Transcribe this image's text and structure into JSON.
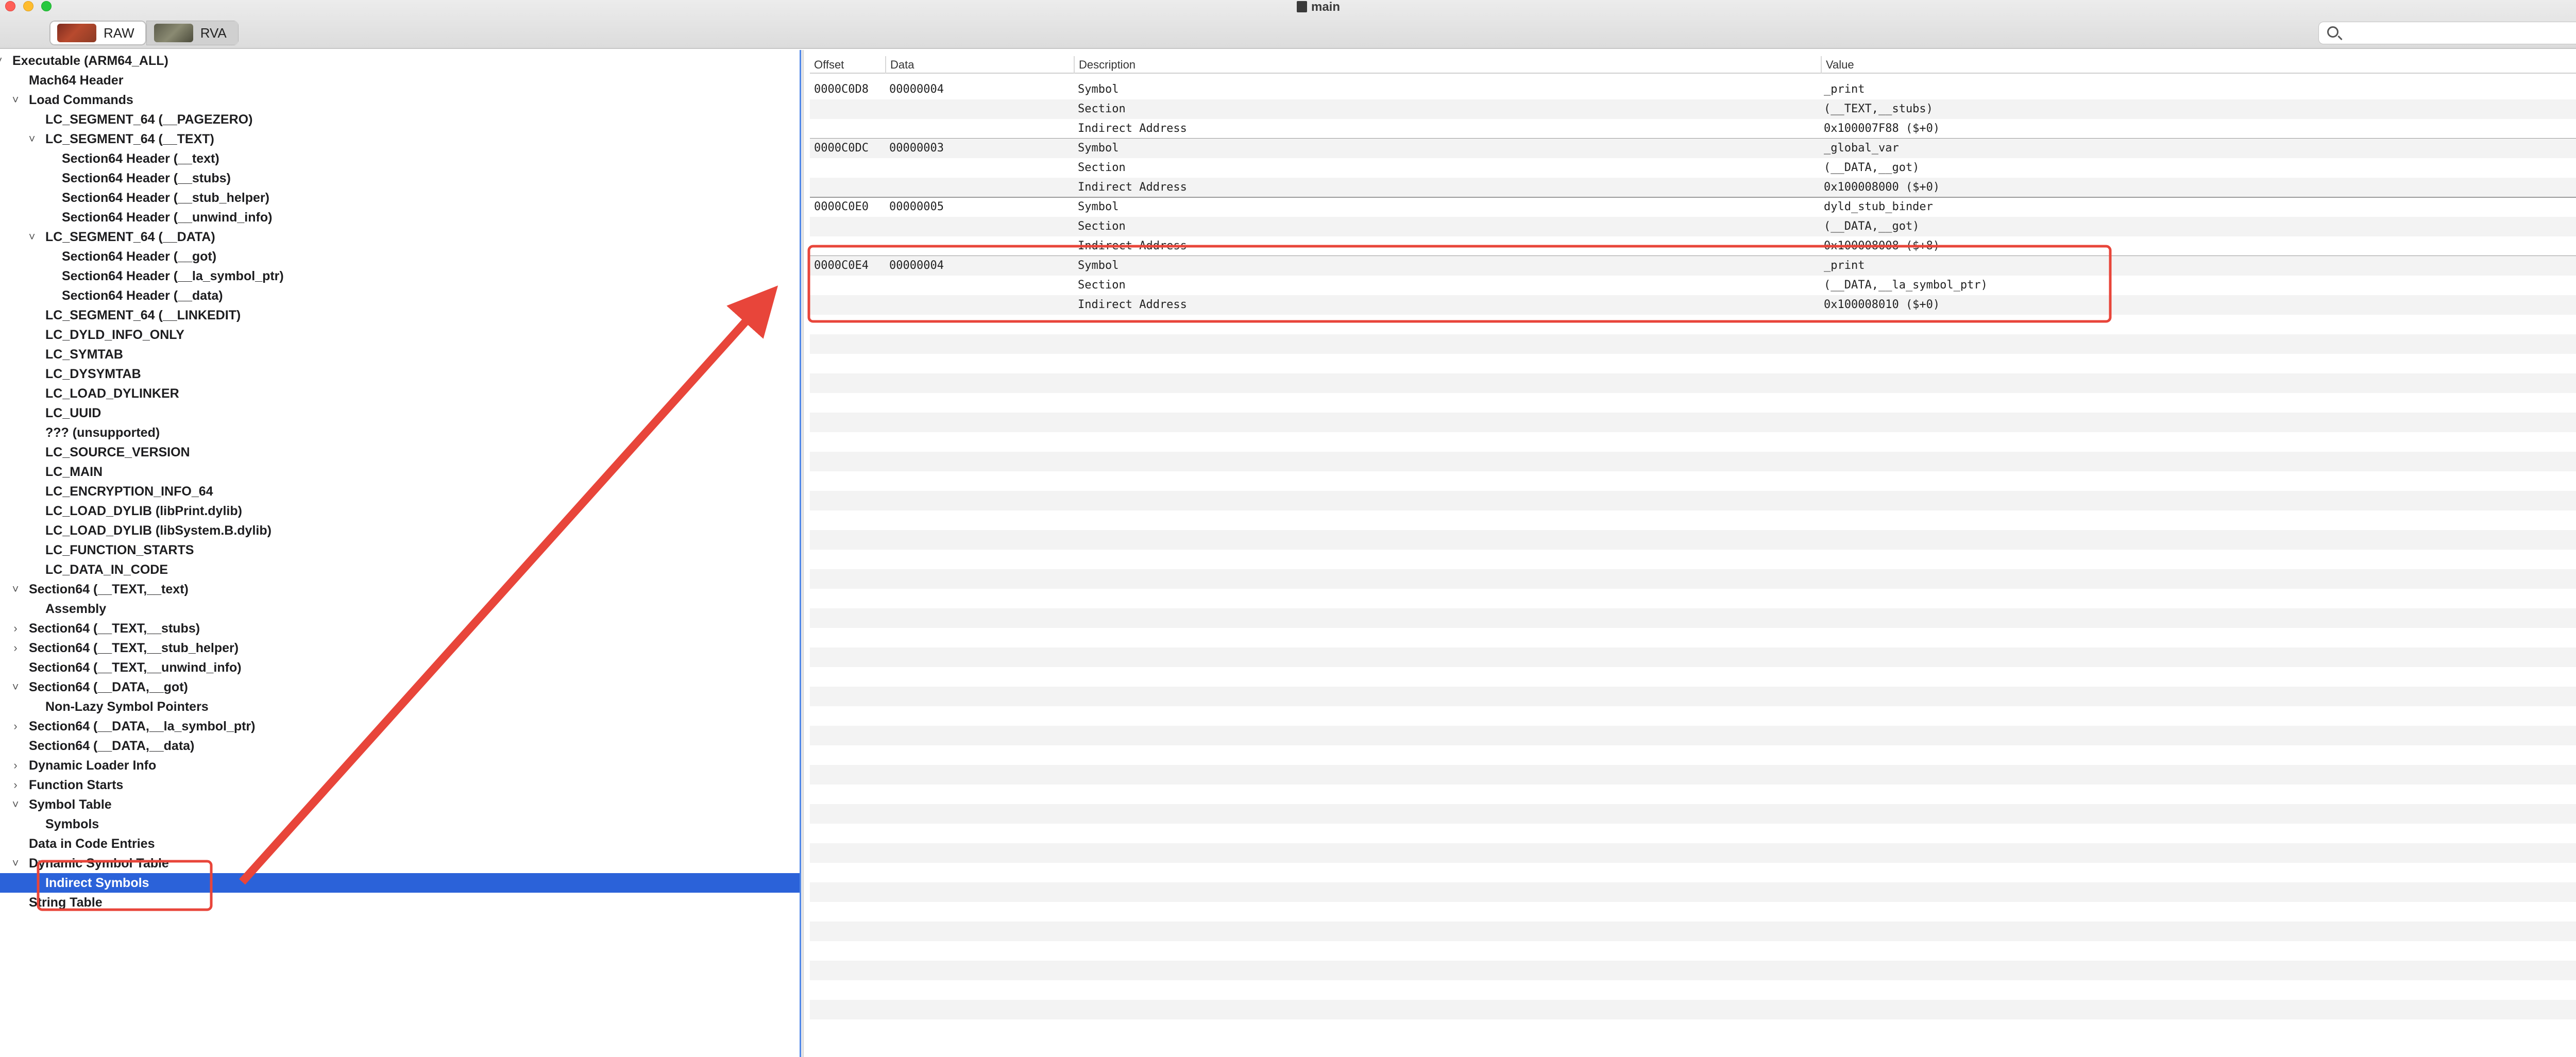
{
  "window": {
    "title": "main"
  },
  "toolbar": {
    "segments": [
      {
        "label": "RAW",
        "icon": "raw-thumbnail-icon"
      },
      {
        "label": "RVA",
        "icon": "rva-thumbnail-icon"
      }
    ],
    "search_placeholder": ""
  },
  "outline": {
    "selected_label": "Indirect Symbols",
    "items": [
      {
        "label": "Executable  (ARM64_ALL)",
        "depth": 0,
        "disclosure": "expanded"
      },
      {
        "label": "Mach64 Header",
        "depth": 1,
        "disclosure": "none"
      },
      {
        "label": "Load Commands",
        "depth": 1,
        "disclosure": "expanded"
      },
      {
        "label": "LC_SEGMENT_64 (__PAGEZERO)",
        "depth": 2,
        "disclosure": "none"
      },
      {
        "label": "LC_SEGMENT_64 (__TEXT)",
        "depth": 2,
        "disclosure": "expanded"
      },
      {
        "label": "Section64 Header (__text)",
        "depth": 3,
        "disclosure": "none"
      },
      {
        "label": "Section64 Header (__stubs)",
        "depth": 3,
        "disclosure": "none"
      },
      {
        "label": "Section64 Header (__stub_helper)",
        "depth": 3,
        "disclosure": "none"
      },
      {
        "label": "Section64 Header (__unwind_info)",
        "depth": 3,
        "disclosure": "none"
      },
      {
        "label": "LC_SEGMENT_64 (__DATA)",
        "depth": 2,
        "disclosure": "expanded"
      },
      {
        "label": "Section64 Header (__got)",
        "depth": 3,
        "disclosure": "none"
      },
      {
        "label": "Section64 Header (__la_symbol_ptr)",
        "depth": 3,
        "disclosure": "none"
      },
      {
        "label": "Section64 Header (__data)",
        "depth": 3,
        "disclosure": "none"
      },
      {
        "label": "LC_SEGMENT_64 (__LINKEDIT)",
        "depth": 2,
        "disclosure": "none"
      },
      {
        "label": "LC_DYLD_INFO_ONLY",
        "depth": 2,
        "disclosure": "none"
      },
      {
        "label": "LC_SYMTAB",
        "depth": 2,
        "disclosure": "none"
      },
      {
        "label": "LC_DYSYMTAB",
        "depth": 2,
        "disclosure": "none"
      },
      {
        "label": "LC_LOAD_DYLINKER",
        "depth": 2,
        "disclosure": "none"
      },
      {
        "label": "LC_UUID",
        "depth": 2,
        "disclosure": "none"
      },
      {
        "label": "??? (unsupported)",
        "depth": 2,
        "disclosure": "none"
      },
      {
        "label": "LC_SOURCE_VERSION",
        "depth": 2,
        "disclosure": "none"
      },
      {
        "label": "LC_MAIN",
        "depth": 2,
        "disclosure": "none"
      },
      {
        "label": "LC_ENCRYPTION_INFO_64",
        "depth": 2,
        "disclosure": "none"
      },
      {
        "label": "LC_LOAD_DYLIB (libPrint.dylib)",
        "depth": 2,
        "disclosure": "none"
      },
      {
        "label": "LC_LOAD_DYLIB (libSystem.B.dylib)",
        "depth": 2,
        "disclosure": "none"
      },
      {
        "label": "LC_FUNCTION_STARTS",
        "depth": 2,
        "disclosure": "none"
      },
      {
        "label": "LC_DATA_IN_CODE",
        "depth": 2,
        "disclosure": "none"
      },
      {
        "label": "Section64 (__TEXT,__text)",
        "depth": 1,
        "disclosure": "expanded"
      },
      {
        "label": "Assembly",
        "depth": 2,
        "disclosure": "none"
      },
      {
        "label": "Section64 (__TEXT,__stubs)",
        "depth": 1,
        "disclosure": "collapsed"
      },
      {
        "label": "Section64 (__TEXT,__stub_helper)",
        "depth": 1,
        "disclosure": "collapsed"
      },
      {
        "label": "Section64 (__TEXT,__unwind_info)",
        "depth": 1,
        "disclosure": "none"
      },
      {
        "label": "Section64 (__DATA,__got)",
        "depth": 1,
        "disclosure": "expanded"
      },
      {
        "label": "Non-Lazy Symbol Pointers",
        "depth": 2,
        "disclosure": "none"
      },
      {
        "label": "Section64 (__DATA,__la_symbol_ptr)",
        "depth": 1,
        "disclosure": "collapsed"
      },
      {
        "label": "Section64 (__DATA,__data)",
        "depth": 1,
        "disclosure": "none"
      },
      {
        "label": "Dynamic Loader Info",
        "depth": 1,
        "disclosure": "collapsed"
      },
      {
        "label": "Function Starts",
        "depth": 1,
        "disclosure": "collapsed"
      },
      {
        "label": "Symbol Table",
        "depth": 1,
        "disclosure": "expanded"
      },
      {
        "label": "Symbols",
        "depth": 2,
        "disclosure": "none"
      },
      {
        "label": "Data in Code Entries",
        "depth": 1,
        "disclosure": "none"
      },
      {
        "label": "Dynamic Symbol Table",
        "depth": 1,
        "disclosure": "expanded"
      },
      {
        "label": "Indirect Symbols",
        "depth": 2,
        "disclosure": "none"
      },
      {
        "label": "String Table",
        "depth": 1,
        "disclosure": "none"
      }
    ]
  },
  "table": {
    "columns": [
      "Offset",
      "Data",
      "Description",
      "Value"
    ],
    "rows": [
      [
        "0000C0D8",
        "00000004",
        "Symbol",
        "_print"
      ],
      [
        "",
        "",
        "Section",
        "(__TEXT,__stubs)"
      ],
      [
        "",
        "",
        "Indirect Address",
        "0x100007F88 ($+0)"
      ],
      [
        "0000C0DC",
        "00000003",
        "Symbol",
        "_global_var"
      ],
      [
        "",
        "",
        "Section",
        "(__DATA,__got)"
      ],
      [
        "",
        "",
        "Indirect Address",
        "0x100008000 ($+0)"
      ],
      [
        "0000C0E0",
        "00000005",
        "Symbol",
        "dyld_stub_binder"
      ],
      [
        "",
        "",
        "Section",
        "(__DATA,__got)"
      ],
      [
        "",
        "",
        "Indirect Address",
        "0x100008008 ($+8)"
      ],
      [
        "0000C0E4",
        "00000004",
        "Symbol",
        "_print"
      ],
      [
        "",
        "",
        "Section",
        "(__DATA,__la_symbol_ptr)"
      ],
      [
        "",
        "",
        "Indirect Address",
        "0x100008010 ($+0)"
      ]
    ],
    "group_size": 3,
    "empty_stripe_rows": 37
  },
  "colors": {
    "selection": "#2b62d9",
    "annotation": "#e8453a",
    "stripe": "#f3f3f3",
    "pane_divider": "#4f87e8"
  }
}
